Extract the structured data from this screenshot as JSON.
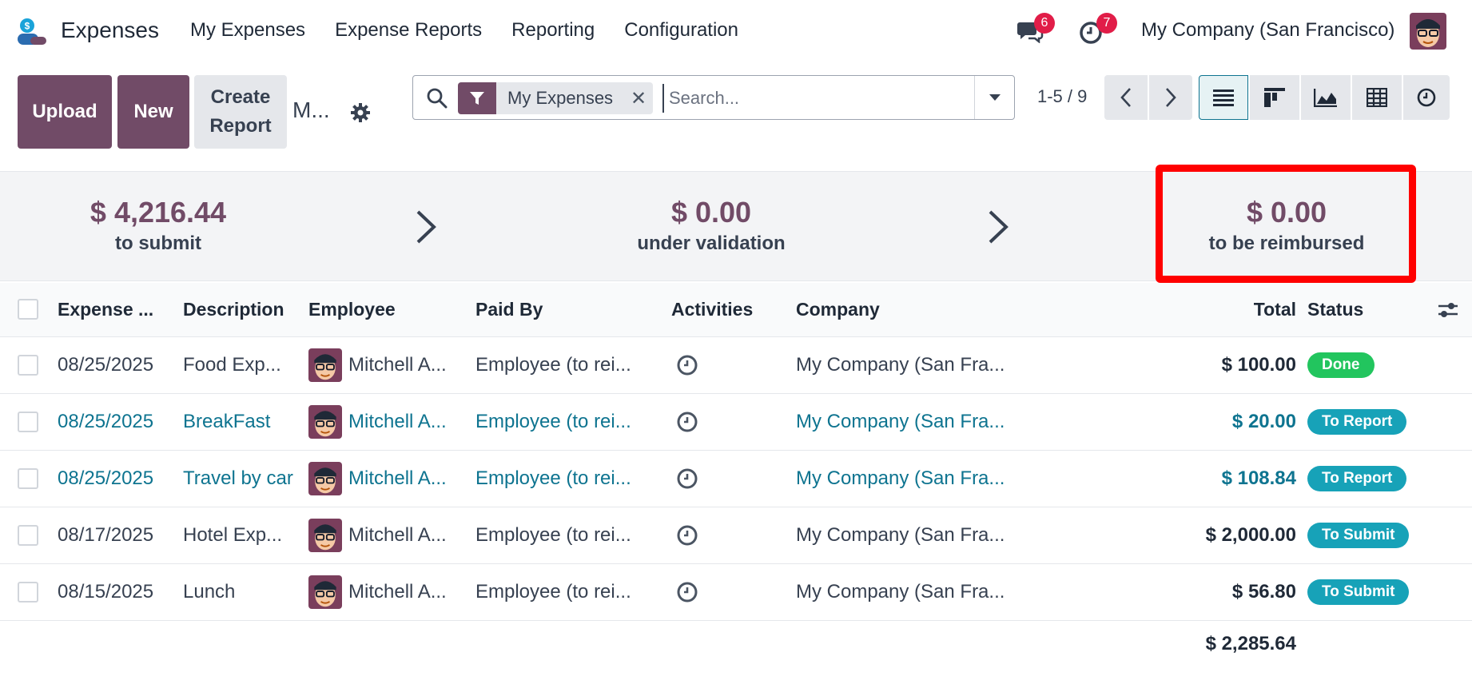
{
  "app": {
    "name": "Expenses",
    "logo_icon": "expenses-app-icon",
    "menu": [
      "My Expenses",
      "Expense Reports",
      "Reporting",
      "Configuration"
    ]
  },
  "systray": {
    "messages_count": "6",
    "activities_count": "7",
    "company": "My Company (San Francisco)",
    "badge_color": "#e11d48"
  },
  "control_panel": {
    "upload_label": "Upload",
    "new_label": "New",
    "create_report_line1": "Create",
    "create_report_line2": "Report",
    "breadcrumb": "M...",
    "search": {
      "facet_label": "My Expenses",
      "placeholder": "Search..."
    },
    "pager": "1-5 / 9",
    "views": [
      "list-view-icon",
      "kanban-view-icon",
      "graph-view-icon",
      "pivot-view-icon",
      "activity-view-icon"
    ],
    "accent_color": "#714b67"
  },
  "summary": {
    "to_submit_amount": "$ 4,216.44",
    "to_submit_label": "to submit",
    "under_validation_amount": "$ 0.00",
    "under_validation_label": "under validation",
    "to_be_reimbursed_amount": "$ 0.00",
    "to_be_reimbursed_label": "to be reimbursed",
    "highlight_color": "#ff0000"
  },
  "table": {
    "headers": {
      "date": "Expense ...",
      "description": "Description",
      "employee": "Employee",
      "paid_by": "Paid By",
      "activities": "Activities",
      "company": "Company",
      "total": "Total",
      "status": "Status"
    },
    "rows": [
      {
        "date": "08/25/2025",
        "description": "Food Exp...",
        "employee": "Mitchell A...",
        "paid_by": "Employee (to rei...",
        "company": "My Company (San Fra...",
        "total": "$ 100.00",
        "status": "Done"
      },
      {
        "date": "08/25/2025",
        "description": "BreakFast",
        "employee": "Mitchell A...",
        "paid_by": "Employee (to rei...",
        "company": "My Company (San Fra...",
        "total": "$ 20.00",
        "status": "To Report"
      },
      {
        "date": "08/25/2025",
        "description": "Travel by car",
        "employee": "Mitchell A...",
        "paid_by": "Employee (to rei...",
        "company": "My Company (San Fra...",
        "total": "$ 108.84",
        "status": "To Report"
      },
      {
        "date": "08/17/2025",
        "description": "Hotel Exp...",
        "employee": "Mitchell A...",
        "paid_by": "Employee (to rei...",
        "company": "My Company (San Fra...",
        "total": "$ 2,000.00",
        "status": "To Submit"
      },
      {
        "date": "08/15/2025",
        "description": "Lunch",
        "employee": "Mitchell A...",
        "paid_by": "Employee (to rei...",
        "company": "My Company (San Fra...",
        "total": "$ 56.80",
        "status": "To Submit"
      }
    ],
    "grand_total": "$ 2,285.64"
  }
}
